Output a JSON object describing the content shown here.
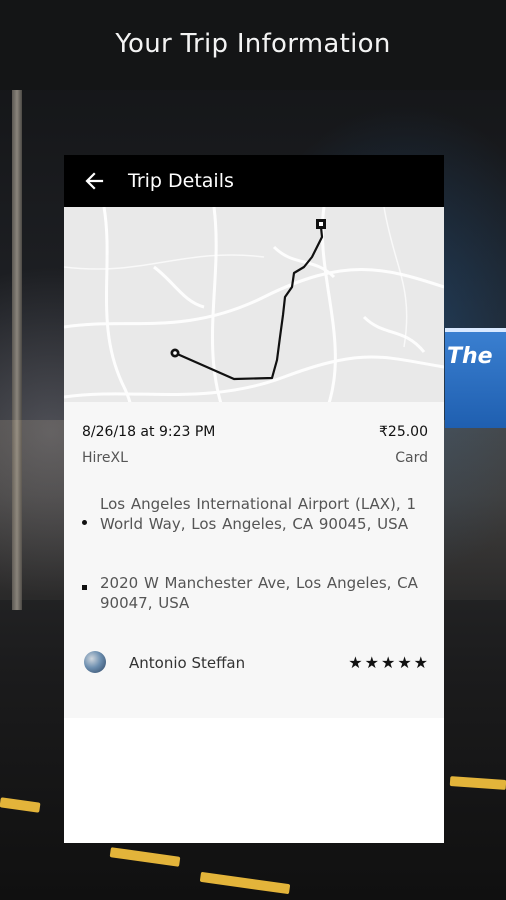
{
  "header": {
    "title": "Your Trip Information"
  },
  "background": {
    "sign_text": "The"
  },
  "toolbar": {
    "back_icon": "arrow-left-icon",
    "title": "Trip Details"
  },
  "trip": {
    "datetime": "8/26/18 at 9:23 PM",
    "fare": "₹25.00",
    "service": "HireXL",
    "payment": "Card"
  },
  "route": {
    "pickup": "Los Angeles International Airport (LAX), 1 World Way, Los Angeles, CA 90045, USA",
    "dropoff": "2020 W Manchester Ave, Los Angeles, CA 90047, USA"
  },
  "driver": {
    "name": "Antonio Steffan",
    "rating": "★★★★★"
  },
  "colors": {
    "toolbar": "#000000",
    "card": "#ffffff",
    "details": "#f7f7f7",
    "map": "#e9e9e9"
  }
}
